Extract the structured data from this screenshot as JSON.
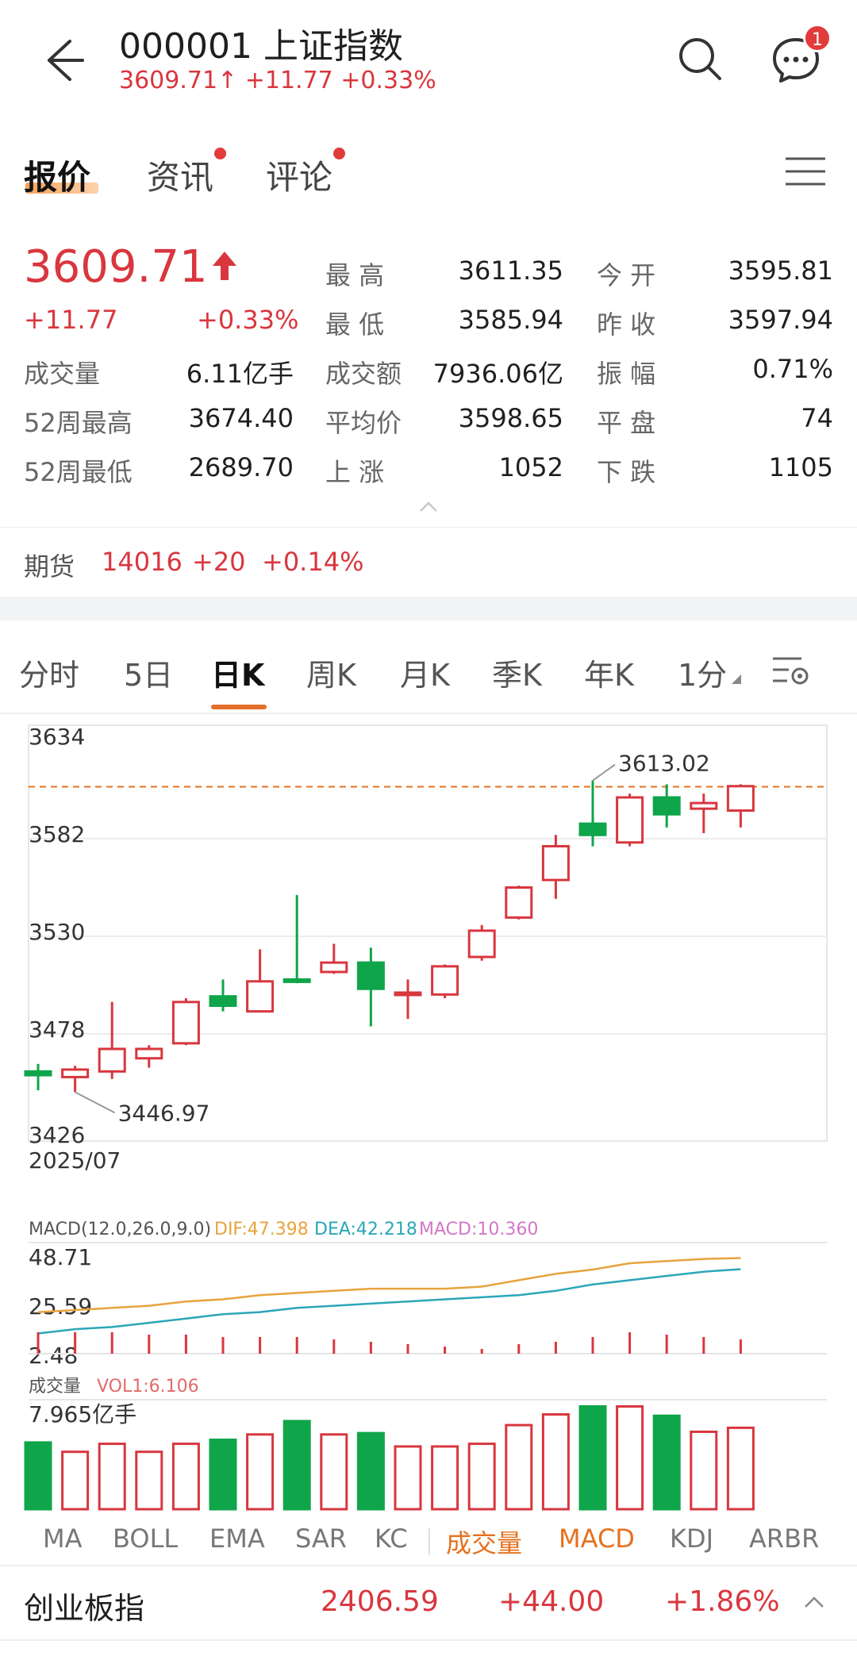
{
  "header": {
    "title": "000001  上证指数",
    "subtitle": "3609.71↑ +11.77 +0.33%",
    "badge": "1"
  },
  "tabs": [
    {
      "label": "报价",
      "active": true
    },
    {
      "label": "资讯",
      "dot": true
    },
    {
      "label": "评论",
      "dot": true
    }
  ],
  "quote": {
    "price": "3609.71",
    "change": "+11.77",
    "change_pct": "+0.33%",
    "rows": [
      {
        "l1": "",
        "v1": "",
        "l2": "最 高",
        "v2": "3611.35",
        "l3": "今 开",
        "v3": "3595.81"
      },
      {
        "l1": "",
        "v1": "",
        "l2": "最 低",
        "v2": "3585.94",
        "l3": "昨 收",
        "v3": "3597.94"
      },
      {
        "l1": "成交量",
        "v1": "6.11亿手",
        "l2": "成交额",
        "v2": "7936.06亿",
        "l3": "振 幅",
        "v3": "0.71%"
      },
      {
        "l1": "52周最高",
        "v1": "3674.40",
        "l2": "平均价",
        "v2": "3598.65",
        "l3": "平 盘",
        "v3": "74"
      },
      {
        "l1": "52周最低",
        "v1": "2689.70",
        "l2": "上 涨",
        "v2": "1052",
        "l3": "下 跌",
        "v3": "1105"
      }
    ]
  },
  "futures": {
    "label": "期货",
    "value": "14016",
    "change": "+20",
    "pct": "+0.14%"
  },
  "chart_tabs": [
    "分时",
    "5日",
    "日K",
    "周K",
    "月K",
    "季K",
    "年K",
    "1分"
  ],
  "chart_tabs_active": "日K",
  "colors": {
    "up": "#d9363e",
    "down": "#0fa54a",
    "accent": "#e5711f",
    "dif": "#e8a33d",
    "dea": "#2aa6b8",
    "macd": "#d277c8"
  },
  "chart_data": [
    {
      "type": "candlestick",
      "name": "K-line",
      "date_label": "2025/07",
      "ylim": [
        3426,
        3634
      ],
      "y_ticks": [
        "3634",
        "3582",
        "3530",
        "3478",
        "3426"
      ],
      "max_label": "3613.02",
      "min_label": "3446.97",
      "ref_line": 3609.71,
      "candles": [
        {
          "o": 3458,
          "c": 3456,
          "h": 3462,
          "l": 3448
        },
        {
          "o": 3455,
          "c": 3459,
          "h": 3461,
          "l": 3447
        },
        {
          "o": 3458,
          "c": 3470,
          "h": 3495,
          "l": 3454
        },
        {
          "o": 3465,
          "c": 3470,
          "h": 3472,
          "l": 3460
        },
        {
          "o": 3473,
          "c": 3495,
          "h": 3497,
          "l": 3472
        },
        {
          "o": 3498,
          "c": 3493,
          "h": 3507,
          "l": 3490
        },
        {
          "o": 3490,
          "c": 3506,
          "h": 3523,
          "l": 3490
        },
        {
          "o": 3507,
          "c": 3506,
          "h": 3552,
          "l": 3505
        },
        {
          "o": 3511,
          "c": 3516,
          "h": 3526,
          "l": 3510
        },
        {
          "o": 3516,
          "c": 3502,
          "h": 3524,
          "l": 3482
        },
        {
          "o": 3499,
          "c": 3500,
          "h": 3507,
          "l": 3486
        },
        {
          "o": 3499,
          "c": 3514,
          "h": 3515,
          "l": 3497
        },
        {
          "o": 3519,
          "c": 3533,
          "h": 3536,
          "l": 3517
        },
        {
          "o": 3540,
          "c": 3556,
          "h": 3557,
          "l": 3539
        },
        {
          "o": 3560,
          "c": 3578,
          "h": 3584,
          "l": 3550
        },
        {
          "o": 3590,
          "c": 3584,
          "h": 3613.02,
          "l": 3578
        },
        {
          "o": 3580,
          "c": 3604,
          "h": 3606,
          "l": 3578
        },
        {
          "o": 3604,
          "c": 3595,
          "h": 3611,
          "l": 3588
        },
        {
          "o": 3598,
          "c": 3601,
          "h": 3606,
          "l": 3585
        },
        {
          "o": 3597,
          "c": 3610,
          "h": 3611,
          "l": 3588
        }
      ]
    },
    {
      "type": "line",
      "name": "MACD",
      "header": "MACD(12.0,26.0,9.0)",
      "dif_label": "DIF:47.398",
      "dea_label": "DEA:42.218",
      "macd_label": "MACD:10.360",
      "y_ticks": [
        "48.71",
        "25.59",
        "2.48"
      ],
      "ylim": [
        2.48,
        48.71
      ],
      "dif": [
        22,
        23,
        24,
        25,
        27,
        28,
        30,
        31,
        32,
        33,
        33,
        33,
        34,
        37,
        40,
        42,
        45,
        46,
        47,
        47.4
      ],
      "dea": [
        12,
        14,
        15,
        17,
        19,
        21,
        22,
        24,
        25,
        26,
        27,
        28,
        29,
        30,
        32,
        35,
        37,
        39,
        41,
        42.2
      ],
      "macd": [
        9,
        9,
        9,
        8,
        8,
        7,
        7,
        7,
        6,
        5,
        4,
        3,
        2,
        4,
        5,
        7,
        9,
        8,
        7,
        6
      ]
    },
    {
      "type": "bar",
      "name": "Volume",
      "header": "成交量",
      "vol_label": "VOL1:6.106",
      "y_max_label": "7.965亿手",
      "ymax": 7.965,
      "values": [
        5.0,
        4.3,
        4.9,
        4.3,
        4.9,
        5.2,
        5.6,
        6.6,
        5.6,
        5.7,
        4.7,
        4.7,
        4.9,
        6.3,
        7.1,
        7.7,
        7.7,
        7.0,
        5.8,
        6.1
      ],
      "up": [
        false,
        true,
        true,
        true,
        true,
        false,
        true,
        false,
        true,
        false,
        true,
        true,
        true,
        true,
        true,
        false,
        true,
        false,
        true,
        true
      ]
    }
  ],
  "indicator_tabs": [
    "MA",
    "BOLL",
    "EMA",
    "SAR",
    "KC",
    "成交量",
    "MACD",
    "KDJ",
    "ARBR"
  ],
  "indicator_active": [
    "成交量",
    "MACD"
  ],
  "footer": {
    "name": "创业板指",
    "price": "2406.59",
    "change": "+44.00",
    "pct": "+1.86%"
  }
}
